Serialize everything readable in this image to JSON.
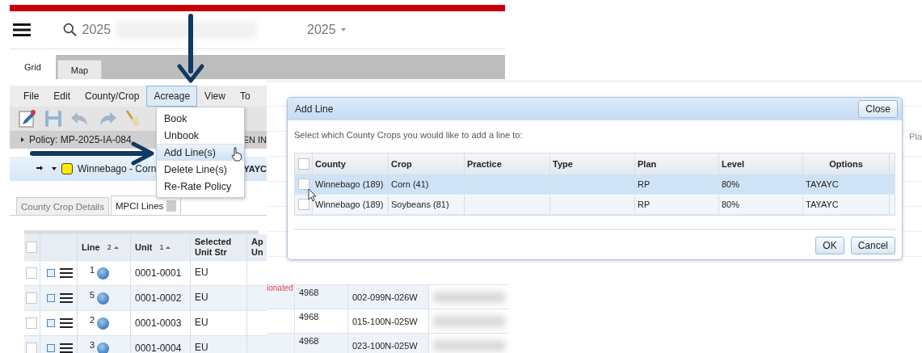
{
  "search": {
    "value": "2025"
  },
  "year_select": {
    "value": "2025"
  },
  "view_tabs": [
    {
      "label": "Grid",
      "selected": true
    },
    {
      "label": "Map",
      "selected": false
    }
  ],
  "menu_bar": [
    {
      "label": "File",
      "selected": false
    },
    {
      "label": "Edit",
      "selected": false
    },
    {
      "label": "County/Crop",
      "selected": false
    },
    {
      "label": "Acreage",
      "selected": true
    },
    {
      "label": "View",
      "selected": false
    },
    {
      "label": "To",
      "selected": false
    }
  ],
  "acreage_menu": [
    {
      "label": "Book",
      "selected": false
    },
    {
      "label": "Unbook",
      "selected": false
    },
    {
      "label": "Add Line(s)",
      "selected": true
    },
    {
      "label": "Delete Line(s)",
      "selected": false
    },
    {
      "label": "Re-Rate Policy",
      "selected": false
    }
  ],
  "policy_bar": {
    "title": "Policy: MP-2025-IA-084",
    "extra": "EN IN"
  },
  "crop_bar": {
    "label": "Winnebago - Corn",
    "options": "YAYC"
  },
  "detail_tabs": [
    {
      "label": "County Crop Details",
      "selected": false
    },
    {
      "label": "MPCI Lines",
      "selected": true
    }
  ],
  "lines_table": {
    "select_all_checked": false,
    "columns": [
      {
        "label": "Line",
        "sort_order": "2"
      },
      {
        "label": "Unit",
        "sort_order": "1"
      },
      {
        "label": "Selected Unit Str"
      },
      {
        "label": "Ap Un"
      }
    ],
    "rows": [
      {
        "line": "1",
        "unit": "0001-0001",
        "structure": "EU",
        "checked": false
      },
      {
        "line": "5",
        "unit": "0001-0002",
        "structure": "EU",
        "checked": false
      },
      {
        "line": "2",
        "unit": "0001-0003",
        "structure": "EU",
        "checked": false
      },
      {
        "line": "3",
        "unit": "0001-0004",
        "structure": "EU",
        "checked": false
      }
    ]
  },
  "background_grid": {
    "column_header": "Pla"
  },
  "dialog": {
    "title": "Add Line",
    "close": "Close",
    "instruction": "Select which County Crops you would like to add a line to:",
    "select_all_checked": false,
    "columns": [
      "County",
      "Crop",
      "Practice",
      "Type",
      "Plan",
      "Level",
      "Options"
    ],
    "rows": [
      {
        "county": "Winnebago (189)",
        "crop": "Corn (41)",
        "plan": "RP",
        "coverage_level": "80%",
        "options": "TAYAYC",
        "selected": true,
        "checked": false
      },
      {
        "county": "Winnebago (189)",
        "crop": "Soybeans (81)",
        "plan": "RP",
        "coverage_level": "80%",
        "options": "TAYAYC",
        "selected": false,
        "checked": false
      }
    ],
    "buttons": [
      "OK",
      "Cancel"
    ]
  },
  "lower_grid": {
    "status": "ionated",
    "rows": [
      {
        "column_1": "4968",
        "column_2": "002-099N-026W"
      },
      {
        "column_1": "4968",
        "column_2": "015-100N-025W"
      },
      {
        "column_1": "4968",
        "column_2": "023-100N-025W"
      }
    ]
  }
}
